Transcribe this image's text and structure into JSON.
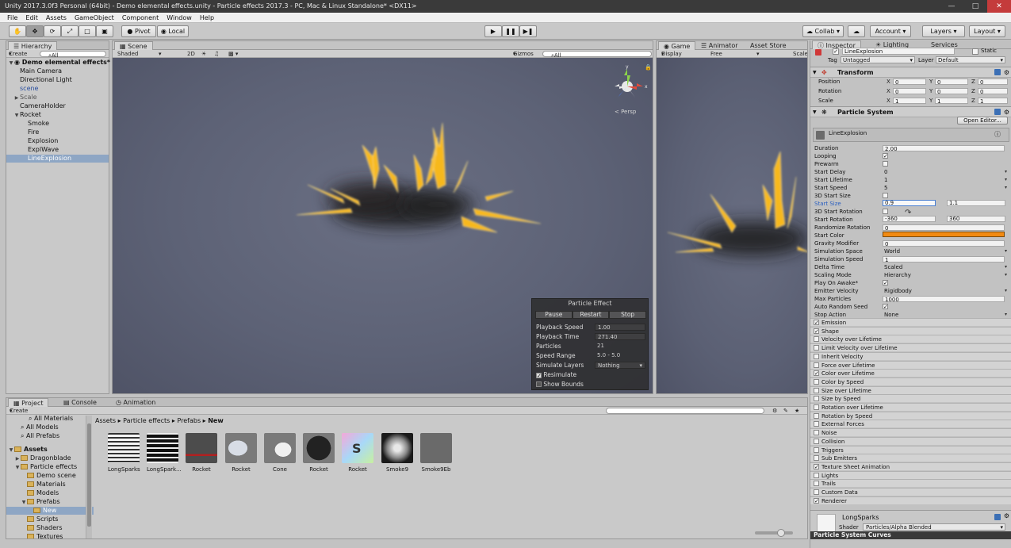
{
  "window": {
    "title": "Unity 2017.3.0f3 Personal (64bit) - Demo elemental effects.unity - Particle effects 2017.3 - PC, Mac & Linux Standalone* <DX11>"
  },
  "menu": [
    "File",
    "Edit",
    "Assets",
    "GameObject",
    "Component",
    "Window",
    "Help"
  ],
  "toolbar": {
    "pivot": "Pivot",
    "local": "Local",
    "collab": "Collab",
    "account": "Account",
    "layers": "Layers",
    "layout": "Layout"
  },
  "hierarchy": {
    "tab": "Hierarchy",
    "create": "Create",
    "search": "⌕All",
    "items": [
      {
        "label": "Demo elemental effects*"
      },
      {
        "label": "Main Camera"
      },
      {
        "label": "Directional Light"
      },
      {
        "label": "scene"
      },
      {
        "label": "Scale"
      },
      {
        "label": "CameraHolder"
      },
      {
        "label": "Rocket"
      },
      {
        "label": "Smoke"
      },
      {
        "label": "Fire"
      },
      {
        "label": "Explosion"
      },
      {
        "label": "ExplWave"
      },
      {
        "label": "LineExplosion"
      }
    ]
  },
  "scene": {
    "tab": "Scene",
    "shaded": "Shaded",
    "mode2d": "2D",
    "gizmos": "Gizmos",
    "search": "⌕All",
    "persp": "< Persp"
  },
  "game": {
    "tabs": [
      "Game",
      "Animator",
      "Asset Store"
    ],
    "display": "Display 1",
    "aspect": "Free Aspect",
    "scale": "Scale"
  },
  "particle_effect": {
    "title": "Particle Effect",
    "pause": "Pause",
    "restart": "Restart",
    "stop": "Stop",
    "rows": [
      {
        "label": "Playback Speed",
        "value": "1.00"
      },
      {
        "label": "Playback Time",
        "value": "271.40"
      },
      {
        "label": "Particles",
        "value": "21"
      },
      {
        "label": "Speed Range",
        "value": "5.0 - 5.0"
      },
      {
        "label": "Simulate Layers",
        "value": "Nothing"
      }
    ],
    "resimulate": "Resimulate",
    "show_bounds": "Show Bounds"
  },
  "inspector": {
    "tabs": [
      "Inspector",
      "Lighting",
      "Services"
    ],
    "object_name": "LineExplosion",
    "static": "Static",
    "tag_label": "Tag",
    "tag": "Untagged",
    "layer_label": "Layer",
    "layer": "Default",
    "transform": {
      "title": "Transform",
      "rows": [
        {
          "label": "Position",
          "x": "0",
          "y": "0",
          "z": "0"
        },
        {
          "label": "Rotation",
          "x": "0",
          "y": "0",
          "z": "0"
        },
        {
          "label": "Scale",
          "x": "1",
          "y": "1",
          "z": "1"
        }
      ]
    },
    "particle_system": {
      "title": "Particle System",
      "open_editor": "Open Editor...",
      "name": "LineExplosion",
      "start_size": "0.9",
      "start_size_max": "1.1",
      "start_rotation_min": "-360",
      "start_rotation_max": "360",
      "rows": [
        {
          "label": "Duration",
          "value": "2.00"
        },
        {
          "label": "Looping",
          "value": "✓"
        },
        {
          "label": "Prewarm",
          "value": ""
        },
        {
          "label": "Start Delay",
          "value": "0"
        },
        {
          "label": "Start Lifetime",
          "value": "1"
        },
        {
          "label": "Start Speed",
          "value": "5"
        },
        {
          "label": "3D Start Size",
          "value": ""
        },
        {
          "label": "Start Size",
          "value": ""
        },
        {
          "label": "3D Start Rotation",
          "value": ""
        },
        {
          "label": "Start Rotation",
          "value": ""
        },
        {
          "label": "Randomize Rotation",
          "value": "0"
        },
        {
          "label": "Start Color",
          "value": ""
        },
        {
          "label": "Gravity Modifier",
          "value": "0"
        },
        {
          "label": "Simulation Space",
          "value": "World"
        },
        {
          "label": "Simulation Speed",
          "value": "1"
        },
        {
          "label": "Delta Time",
          "value": "Scaled"
        },
        {
          "label": "Scaling Mode",
          "value": "Hierarchy"
        },
        {
          "label": "Play On Awake*",
          "value": "✓"
        },
        {
          "label": "Emitter Velocity",
          "value": "Rigidbody"
        },
        {
          "label": "Max Particles",
          "value": "1000"
        },
        {
          "label": "Auto Random Seed",
          "value": "✓"
        },
        {
          "label": "Stop Action",
          "value": "None"
        }
      ],
      "modules": [
        {
          "label": "Emission",
          "on": true
        },
        {
          "label": "Shape",
          "on": true
        },
        {
          "label": "Velocity over Lifetime",
          "on": false
        },
        {
          "label": "Limit Velocity over Lifetime",
          "on": false
        },
        {
          "label": "Inherit Velocity",
          "on": false
        },
        {
          "label": "Force over Lifetime",
          "on": false
        },
        {
          "label": "Color over Lifetime",
          "on": true
        },
        {
          "label": "Color by Speed",
          "on": false
        },
        {
          "label": "Size over Lifetime",
          "on": false
        },
        {
          "label": "Size by Speed",
          "on": false
        },
        {
          "label": "Rotation over Lifetime",
          "on": false
        },
        {
          "label": "Rotation by Speed",
          "on": false
        },
        {
          "label": "External Forces",
          "on": false
        },
        {
          "label": "Noise",
          "on": false
        },
        {
          "label": "Collision",
          "on": false
        },
        {
          "label": "Triggers",
          "on": false
        },
        {
          "label": "Sub Emitters",
          "on": false
        },
        {
          "label": "Texture Sheet Animation",
          "on": true
        },
        {
          "label": "Lights",
          "on": false
        },
        {
          "label": "Trails",
          "on": false
        },
        {
          "label": "Custom Data",
          "on": false
        },
        {
          "label": "Renderer",
          "on": true
        }
      ]
    },
    "material": {
      "name": "LongSparks",
      "shader_label": "Shader",
      "shader": "Particles/Alpha Blended"
    },
    "curves": "Particle System Curves"
  },
  "project": {
    "tabs": [
      "Project",
      "Console",
      "Animation"
    ],
    "create": "Create",
    "breadcrumb": [
      "Assets",
      "Particle effects",
      "Prefabs",
      "New"
    ],
    "tree": [
      {
        "label": "All Materials"
      },
      {
        "label": "All Models"
      },
      {
        "label": "All Prefabs"
      },
      {
        "label": "Assets"
      },
      {
        "label": "Dragonblade"
      },
      {
        "label": "Particle effects"
      },
      {
        "label": "Demo scene"
      },
      {
        "label": "Materials"
      },
      {
        "label": "Models"
      },
      {
        "label": "Prefabs"
      },
      {
        "label": "New"
      },
      {
        "label": "Scripts"
      },
      {
        "label": "Shaders"
      },
      {
        "label": "Textures"
      }
    ],
    "assets": [
      {
        "name": "LongSparks"
      },
      {
        "name": "LongSpark..."
      },
      {
        "name": "Rocket"
      },
      {
        "name": "Rocket"
      },
      {
        "name": "Cone"
      },
      {
        "name": "Rocket"
      },
      {
        "name": "Rocket"
      },
      {
        "name": "Smoke9"
      },
      {
        "name": "Smoke9Eb"
      }
    ]
  },
  "colors": {
    "accent": "#8ea6c4",
    "start_color": "#f28a12"
  }
}
